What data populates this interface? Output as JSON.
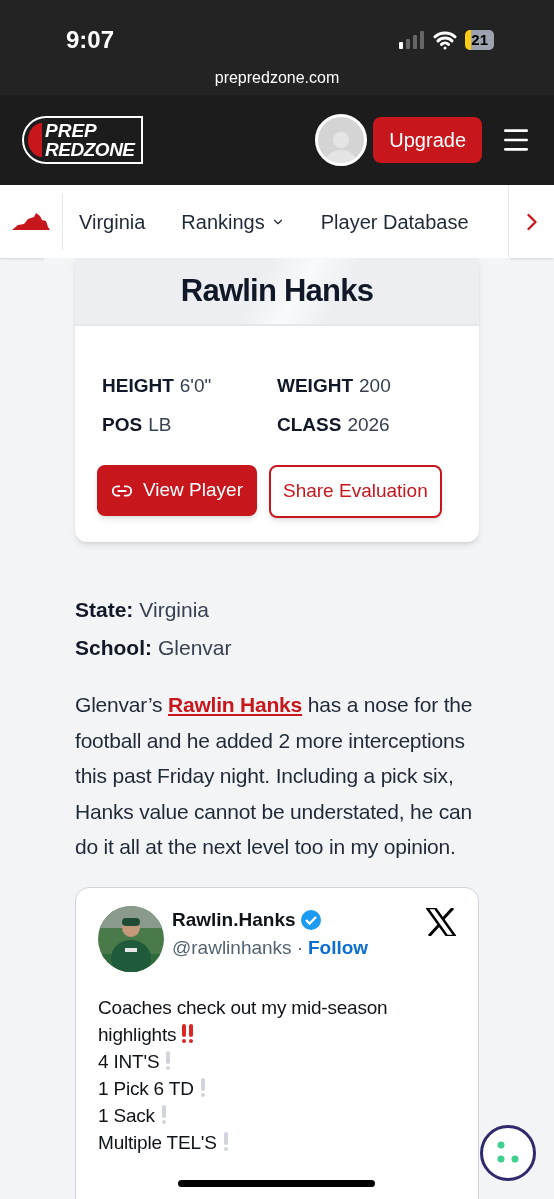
{
  "status_bar": {
    "time": "9:07",
    "battery": "21"
  },
  "browser": {
    "url": "prepredzone.com"
  },
  "header": {
    "logo_top": "PREP",
    "logo_bottom": "REDZONE",
    "upgrade": "Upgrade"
  },
  "subnav": {
    "items": [
      {
        "label": "Virginia",
        "dropdown": false
      },
      {
        "label": "Rankings",
        "dropdown": true
      },
      {
        "label": "Player Database",
        "dropdown": false
      }
    ]
  },
  "player_card": {
    "name": "Rawlin Hanks",
    "stats": [
      {
        "label": "HEIGHT",
        "value": "6'0\""
      },
      {
        "label": "WEIGHT",
        "value": "200"
      },
      {
        "label": "POS",
        "value": "LB"
      },
      {
        "label": "CLASS",
        "value": "2026"
      }
    ],
    "view_button": "View Player",
    "share_button": "Share Evaluation"
  },
  "details": [
    {
      "label": "State:",
      "value": "Virginia"
    },
    {
      "label": "School:",
      "value": "Glenvar"
    }
  ],
  "article": {
    "before": "Glenvar’s",
    "link": "Rawlin Hanks",
    "after": "has a nose for the football and he added 2 more interceptions this past Friday night. Including a pick six, Hanks value cannot be understated, he can do it all at the next level too in my opinion."
  },
  "tweet": {
    "name": "Rawlin.Hanks",
    "verified": true,
    "handle": "@rawlinhanks",
    "separator": "·",
    "follow": "Follow",
    "lines": [
      {
        "text": "Coaches check out my mid-season highlights",
        "kind": "double",
        "color": "#dc2626"
      },
      {
        "text": "4 INT'S",
        "kind": "single",
        "color": "#d1d5db"
      },
      {
        "text": "1 Pick 6 TD",
        "kind": "single",
        "color": "#d1d5db"
      },
      {
        "text": "1 Sack",
        "kind": "single",
        "color": "#d1d5db"
      },
      {
        "text": "Multiple TEL'S",
        "kind": "single",
        "color": "#d1d5db"
      }
    ]
  }
}
